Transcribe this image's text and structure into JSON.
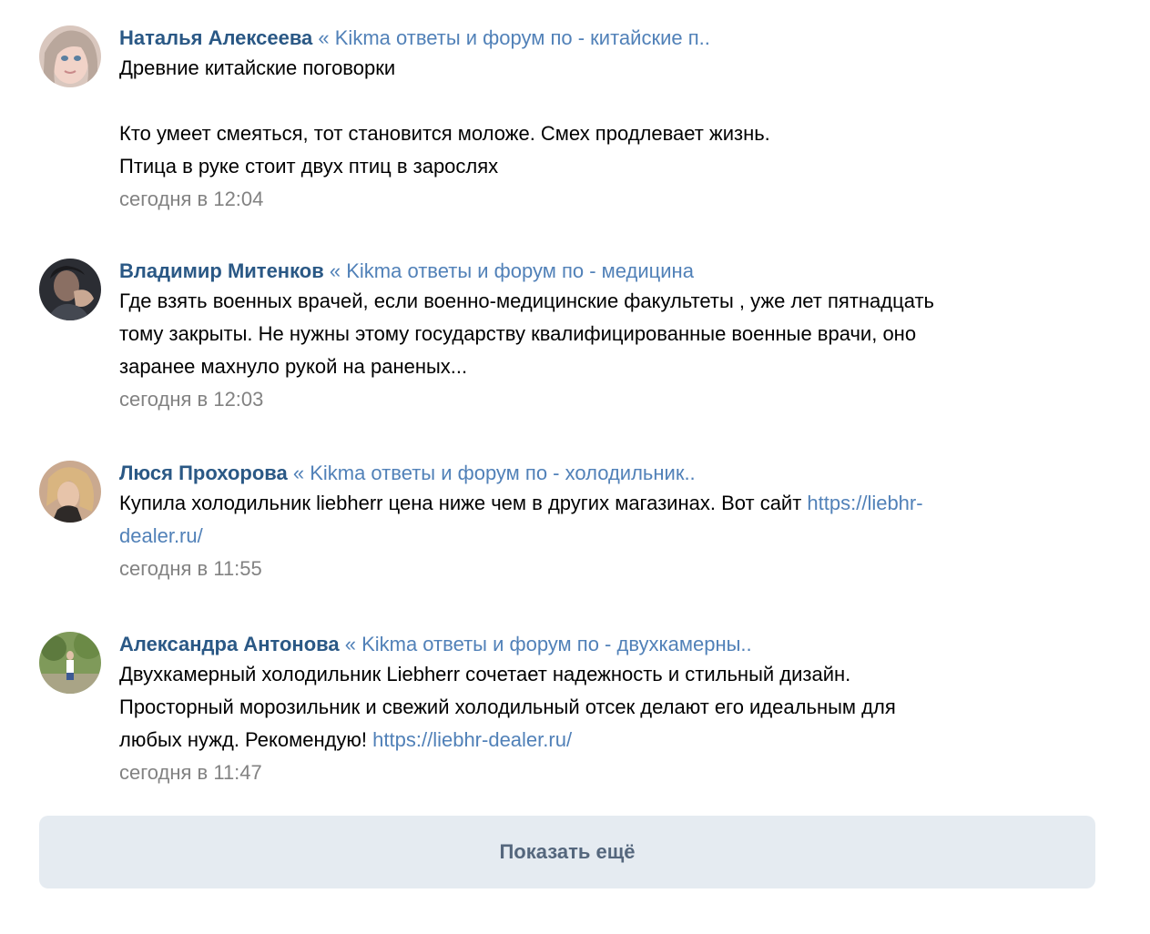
{
  "posts": [
    {
      "author": "Наталья Алексеева",
      "topic": " « Kikma ответы и форум по - китайские п..",
      "lines": [
        "Древние китайские поговорки",
        "",
        "Кто умеет смеяться, тот становится моложе. Смех продлевает жизнь.",
        "Птица в руке стоит двух птиц в зарослях"
      ],
      "time": "сегодня в 12:04"
    },
    {
      "author": "Владимир Митенков",
      "topic": " « Kikma ответы и форум по - медицина",
      "lines": [
        "Где взять военных врачей, если военно-медицинские факультеты , уже лет пятнадцать",
        "тому закрыты. Не нужны этому государству квалифицированные военные врачи, оно",
        "заранее махнуло рукой на раненых..."
      ],
      "time": "сегодня в 12:03"
    },
    {
      "author": "Люся Прохорова",
      "topic": " « Kikma ответы и форум по - холодильник..",
      "text_before_link": "Купила холодильник liebherr цена ниже чем в других магазинах. Вот сайт ",
      "link_part1": "https://liebhr-",
      "link_part2": "dealer.ru/",
      "time": "сегодня в 11:55"
    },
    {
      "author": "Александра Антонова",
      "topic": " « Kikma ответы и форум по - двухкамерны..",
      "line1": "Двухкамерный холодильник Liebherr сочетает надежность и стильный дизайн.",
      "line2": "Просторный морозильник и свежий холодильный отсек делают его идеальным для",
      "line3_text": "любых нужд. Рекомендую! ",
      "line3_link": "https://liebhr-dealer.ru/",
      "time": "сегодня в 11:47"
    }
  ],
  "show_more_label": "Показать ещё",
  "colors": {
    "author": "#2a5885",
    "link": "#5181b8",
    "time": "#828282",
    "button_bg": "#e5ebf1",
    "button_text": "#55677d"
  }
}
